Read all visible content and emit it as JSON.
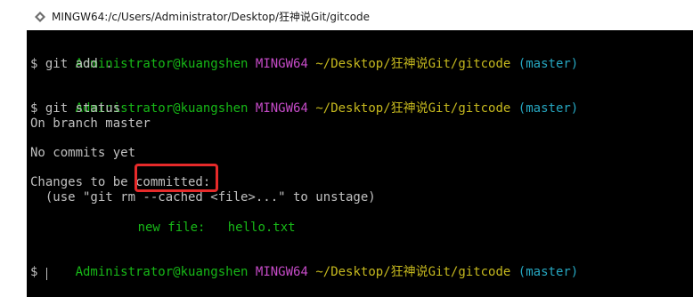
{
  "window": {
    "title": "MINGW64:/c/Users/Administrator/Desktop/狂神说Git/gitcode"
  },
  "prompt": {
    "user_host": "Administrator@kuangshen",
    "shell": "MINGW64",
    "path": "~/Desktop/狂神说Git/gitcode",
    "branch": "(master)",
    "symbol": "$"
  },
  "session": {
    "cmd_add": "$ git add .",
    "cmd_status": "$ git status",
    "on_branch": "On branch master",
    "no_commits": "No commits yet",
    "changes_label": "Changes to be committed:",
    "unstage_hint": "  (use \"git rm --cached <file>...\" to unstage)",
    "new_file_label": "new file:",
    "new_file_name": "hello.txt",
    "final_prompt": "$ "
  },
  "colors": {
    "terminal_bg": "#000000",
    "green": "#17b817",
    "magenta": "#c64bc8",
    "yellow": "#c6b91e",
    "cyan": "#26a7c1",
    "default_text": "#c0c0c0",
    "highlight_box": "#e62a2a"
  },
  "icons": {
    "app_icon": "git-bash-diamond-icon"
  }
}
